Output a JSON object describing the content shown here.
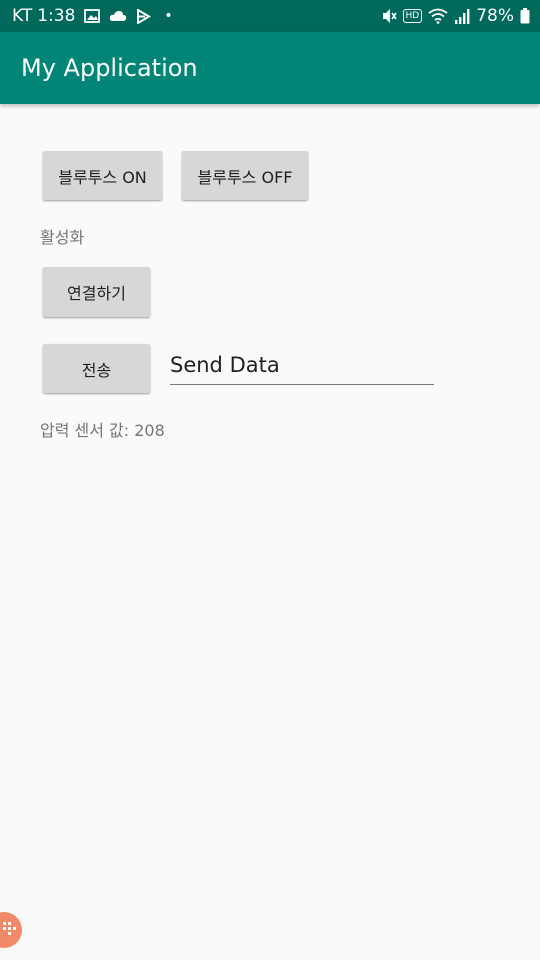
{
  "status_bar": {
    "carrier": "KT",
    "time": "1:38",
    "battery_percent": "78%",
    "icons": [
      "image-icon",
      "cloud-icon",
      "play-store-icon",
      "dot-icon",
      "mute-icon",
      "hd-icon",
      "wifi-icon",
      "signal-icon",
      "battery-icon"
    ],
    "hd_label": "HD",
    "dot": "•"
  },
  "app_bar": {
    "title": "My Application",
    "color": "#008577",
    "status_color": "#00695c"
  },
  "main": {
    "bt_on_label": "블루투스 ON",
    "bt_off_label": "블루투스 OFF",
    "status_text": "활성화",
    "connect_label": "연결하기",
    "send_label": "전송",
    "send_input_value": "Send Data",
    "pressure_text": "압력 센서 값: 208"
  }
}
